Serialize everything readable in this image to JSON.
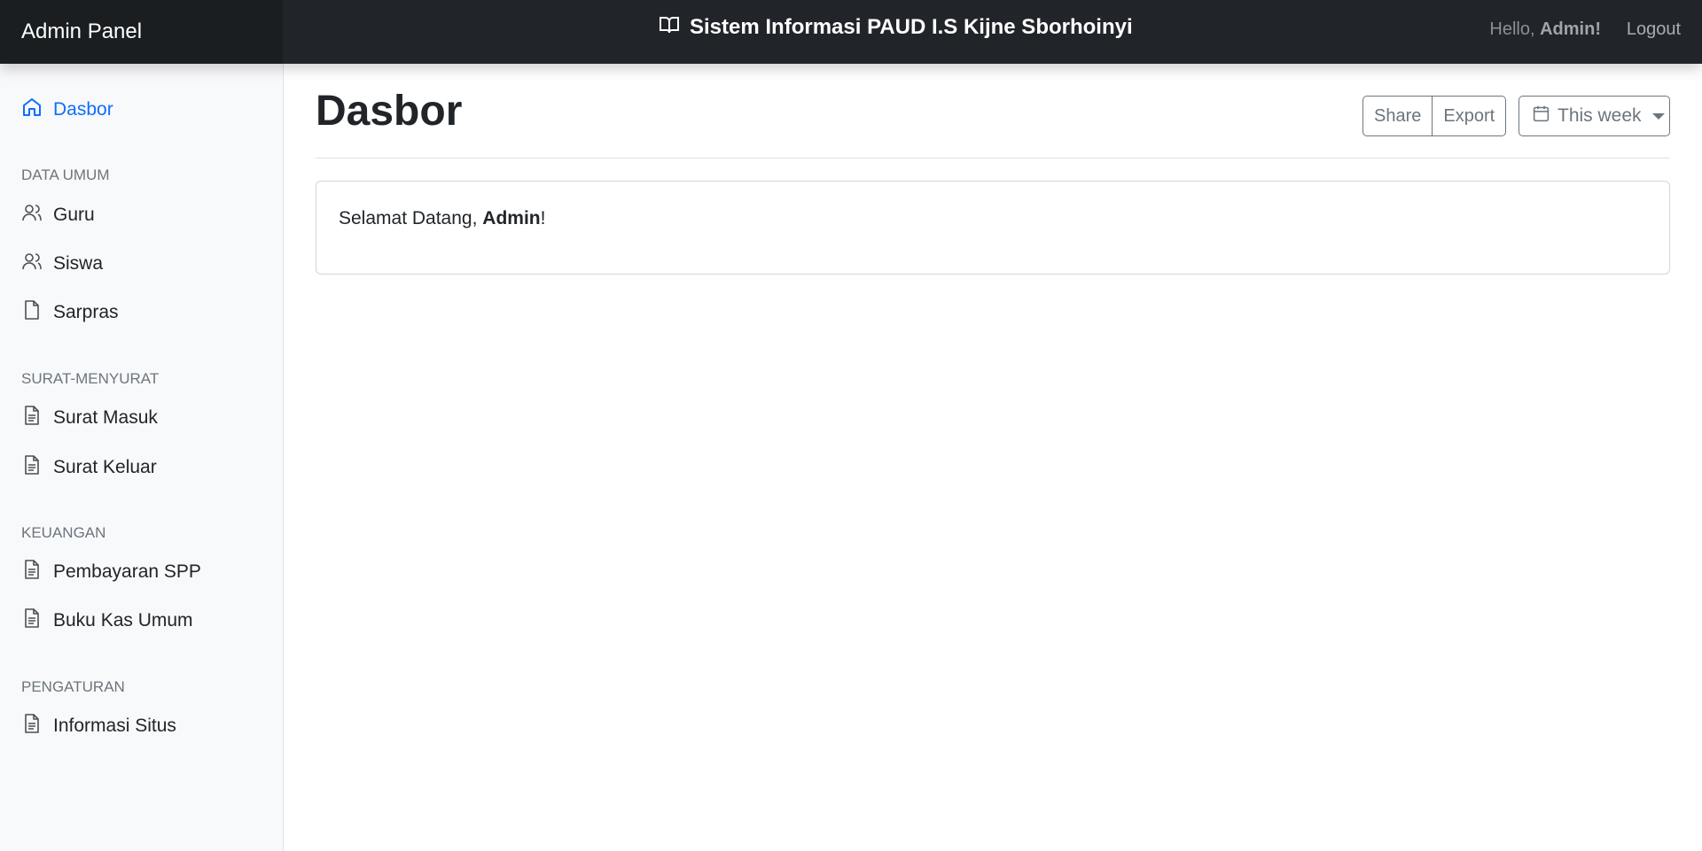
{
  "topbar": {
    "brand": "Admin Panel",
    "site_title": "Sistem Informasi PAUD I.S Kijne Sborhoinyi",
    "hello_prefix": "Hello,",
    "hello_user": "Admin!",
    "logout": "Logout"
  },
  "sidebar": {
    "dashboard": "Dasbor",
    "sections": [
      {
        "title": "DATA UMUM",
        "items": [
          "Guru",
          "Siswa",
          "Sarpras"
        ]
      },
      {
        "title": "SURAT-MENYURAT",
        "items": [
          "Surat Masuk",
          "Surat Keluar"
        ]
      },
      {
        "title": "KEUANGAN",
        "items": [
          "Pembayaran SPP",
          "Buku Kas Umum"
        ]
      },
      {
        "title": "PENGATURAN",
        "items": [
          "Informasi Situs"
        ]
      }
    ]
  },
  "main": {
    "title": "Dasbor",
    "share": "Share",
    "export": "Export",
    "period": "This week",
    "welcome_prefix": "Selamat Datang,",
    "welcome_user": "Admin",
    "welcome_suffix": "!"
  },
  "colors": {
    "active": "#0d6efd",
    "topbar": "#212529"
  }
}
